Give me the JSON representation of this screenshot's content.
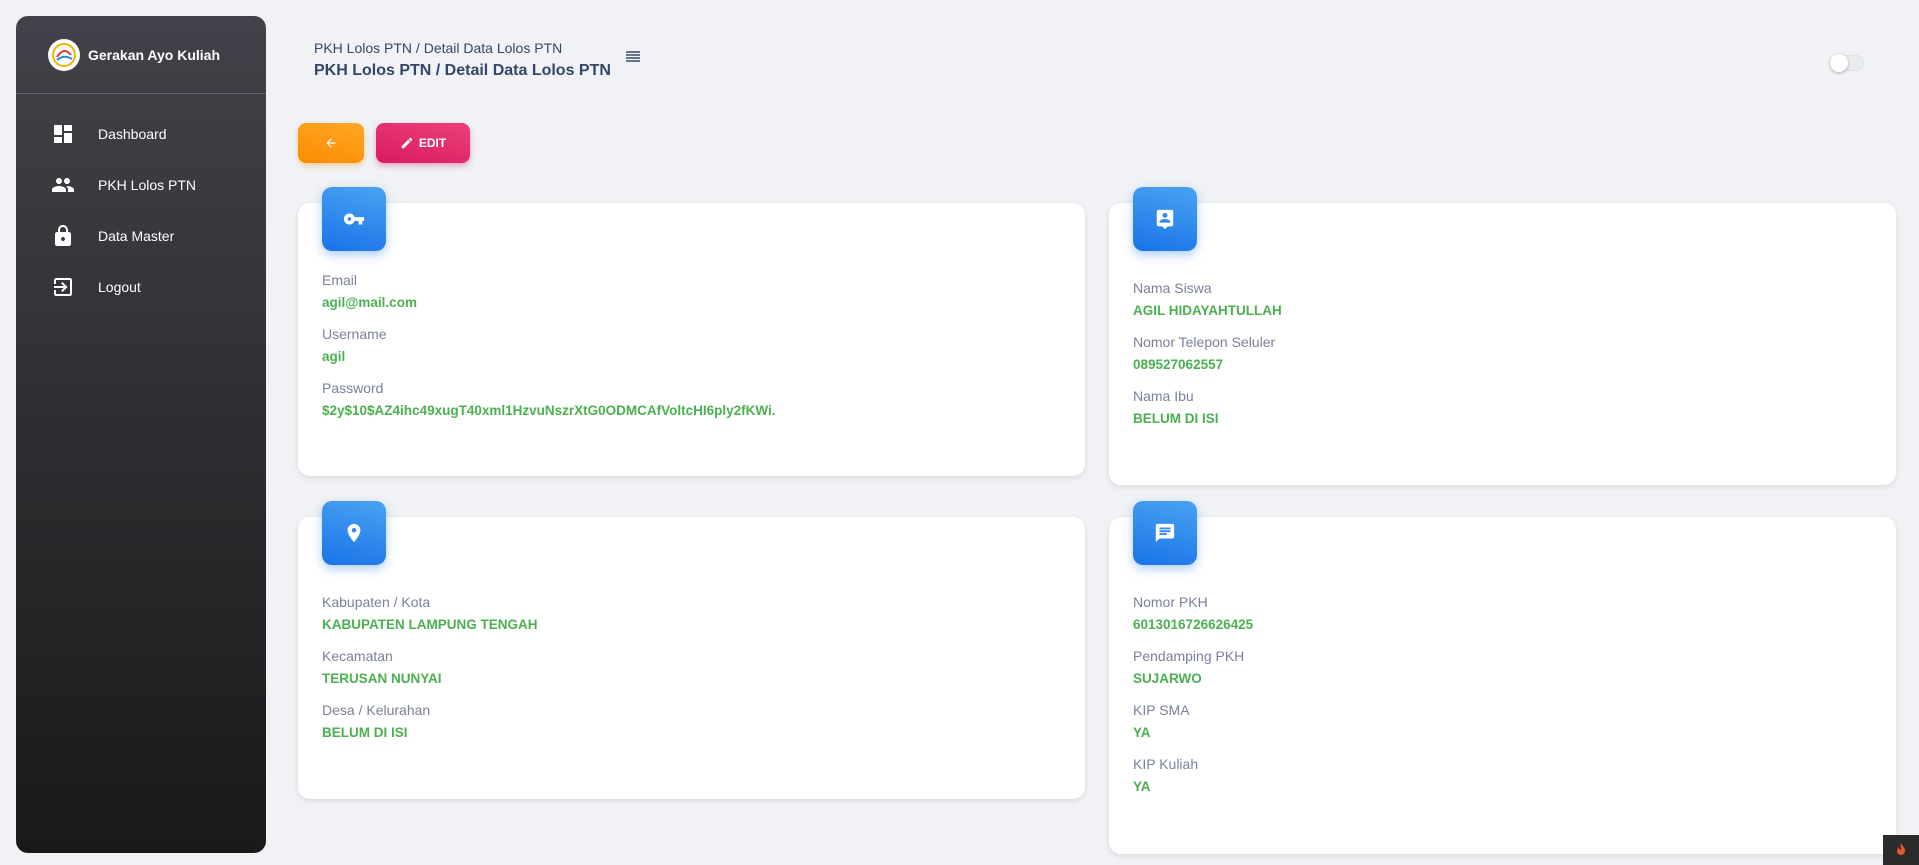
{
  "brand": {
    "name": "Gerakan Ayo Kuliah"
  },
  "sidebar": {
    "items": [
      {
        "label": "Dashboard",
        "icon": "dashboard-icon"
      },
      {
        "label": "PKH Lolos PTN",
        "icon": "people-icon"
      },
      {
        "label": "Data Master",
        "icon": "lock-icon"
      },
      {
        "label": "Logout",
        "icon": "logout-icon"
      }
    ]
  },
  "header": {
    "breadcrumb": "PKH Lolos PTN / Detail Data Lolos PTN",
    "title": "PKH Lolos PTN / Detail Data Lolos PTN"
  },
  "toolbar": {
    "edit_label": "EDIT"
  },
  "cards": {
    "account": {
      "icon": "key-icon",
      "fields": [
        {
          "label": "Email",
          "value": "agil@mail.com"
        },
        {
          "label": "Username",
          "value": "agil"
        },
        {
          "label": "Password",
          "value": "$2y$10$AZ4ihc49xugT40xml1HzvuNszrXtG0ODMCAfVoltcHI6ply2fKWi."
        }
      ]
    },
    "student": {
      "icon": "contact-icon",
      "fields": [
        {
          "label": "Nama Siswa",
          "value": "AGIL HIDAYAHTULLAH"
        },
        {
          "label": "Nomor Telepon Seluler",
          "value": "089527062557"
        },
        {
          "label": "Nama Ibu",
          "value": "BELUM DI ISI"
        }
      ]
    },
    "location": {
      "icon": "location-icon",
      "fields": [
        {
          "label": "Kabupaten / Kota",
          "value": "KABUPATEN LAMPUNG TENGAH"
        },
        {
          "label": "Kecamatan",
          "value": "TERUSAN NUNYAI"
        },
        {
          "label": "Desa / Kelurahan",
          "value": "BELUM DI ISI"
        }
      ]
    },
    "pkh": {
      "icon": "message-icon",
      "fields": [
        {
          "label": "Nomor PKH",
          "value": "6013016726626425"
        },
        {
          "label": "Pendamping PKH",
          "value": "SUJARWO"
        },
        {
          "label": "KIP SMA",
          "value": "YA"
        },
        {
          "label": "KIP Kuliah",
          "value": "YA"
        }
      ]
    }
  },
  "colors": {
    "accent": "#1a73e8",
    "value_green": "#4caf50",
    "back_button": "#fb8c00",
    "edit_button": "#d81b60"
  }
}
